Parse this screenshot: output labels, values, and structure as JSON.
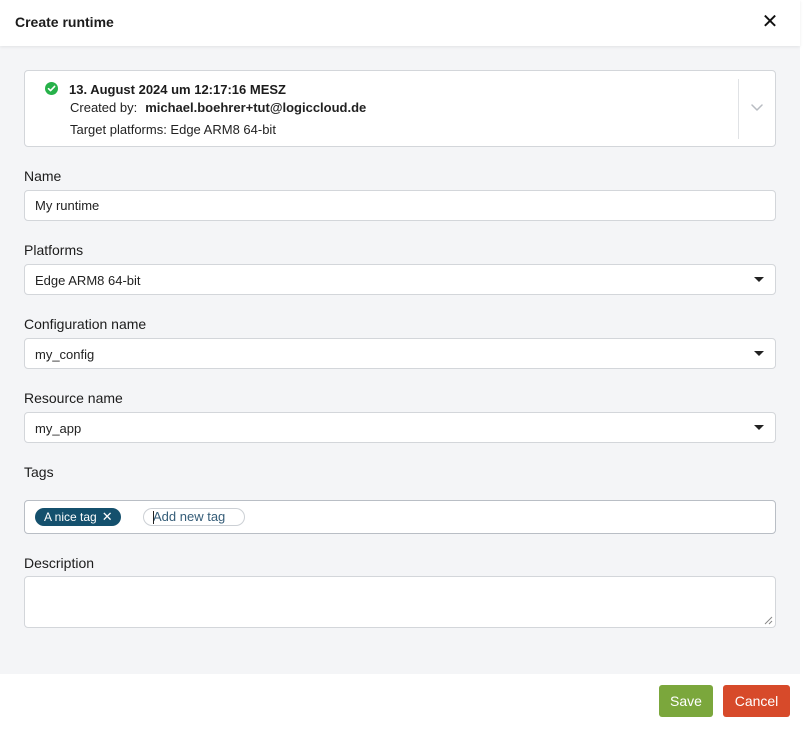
{
  "dialog": {
    "title": "Create runtime",
    "close_icon": "close-icon"
  },
  "info": {
    "status_icon": "check-circle-icon",
    "status_color": "#27b14a",
    "date": "13. August 2024 um 12:17:16 MESZ",
    "created_by_label": "Created by:",
    "created_by_value": "michael.boehrer+tut@logiccloud.de",
    "target_platforms": "Target platforms: Edge ARM8 64-bit",
    "expand_icon": "chevron-down-icon"
  },
  "form": {
    "name_label": "Name",
    "name_value": "My runtime",
    "platforms_label": "Platforms",
    "platforms_value": "Edge ARM8 64-bit",
    "config_label": "Configuration name",
    "config_value": "my_config",
    "resource_label": "Resource name",
    "resource_value": "my_app",
    "tags_label": "Tags",
    "tags": [
      {
        "label": "A nice tag",
        "remove": "✕"
      }
    ],
    "new_tag_placeholder": "Add new tag",
    "description_label": "Description"
  },
  "footer": {
    "save_label": "Save",
    "cancel_label": "Cancel",
    "save_color": "#7ba73c",
    "cancel_color": "#d74a2a"
  },
  "colors": {
    "tag_background": "#14506d",
    "body_background": "#f4f5f7"
  }
}
